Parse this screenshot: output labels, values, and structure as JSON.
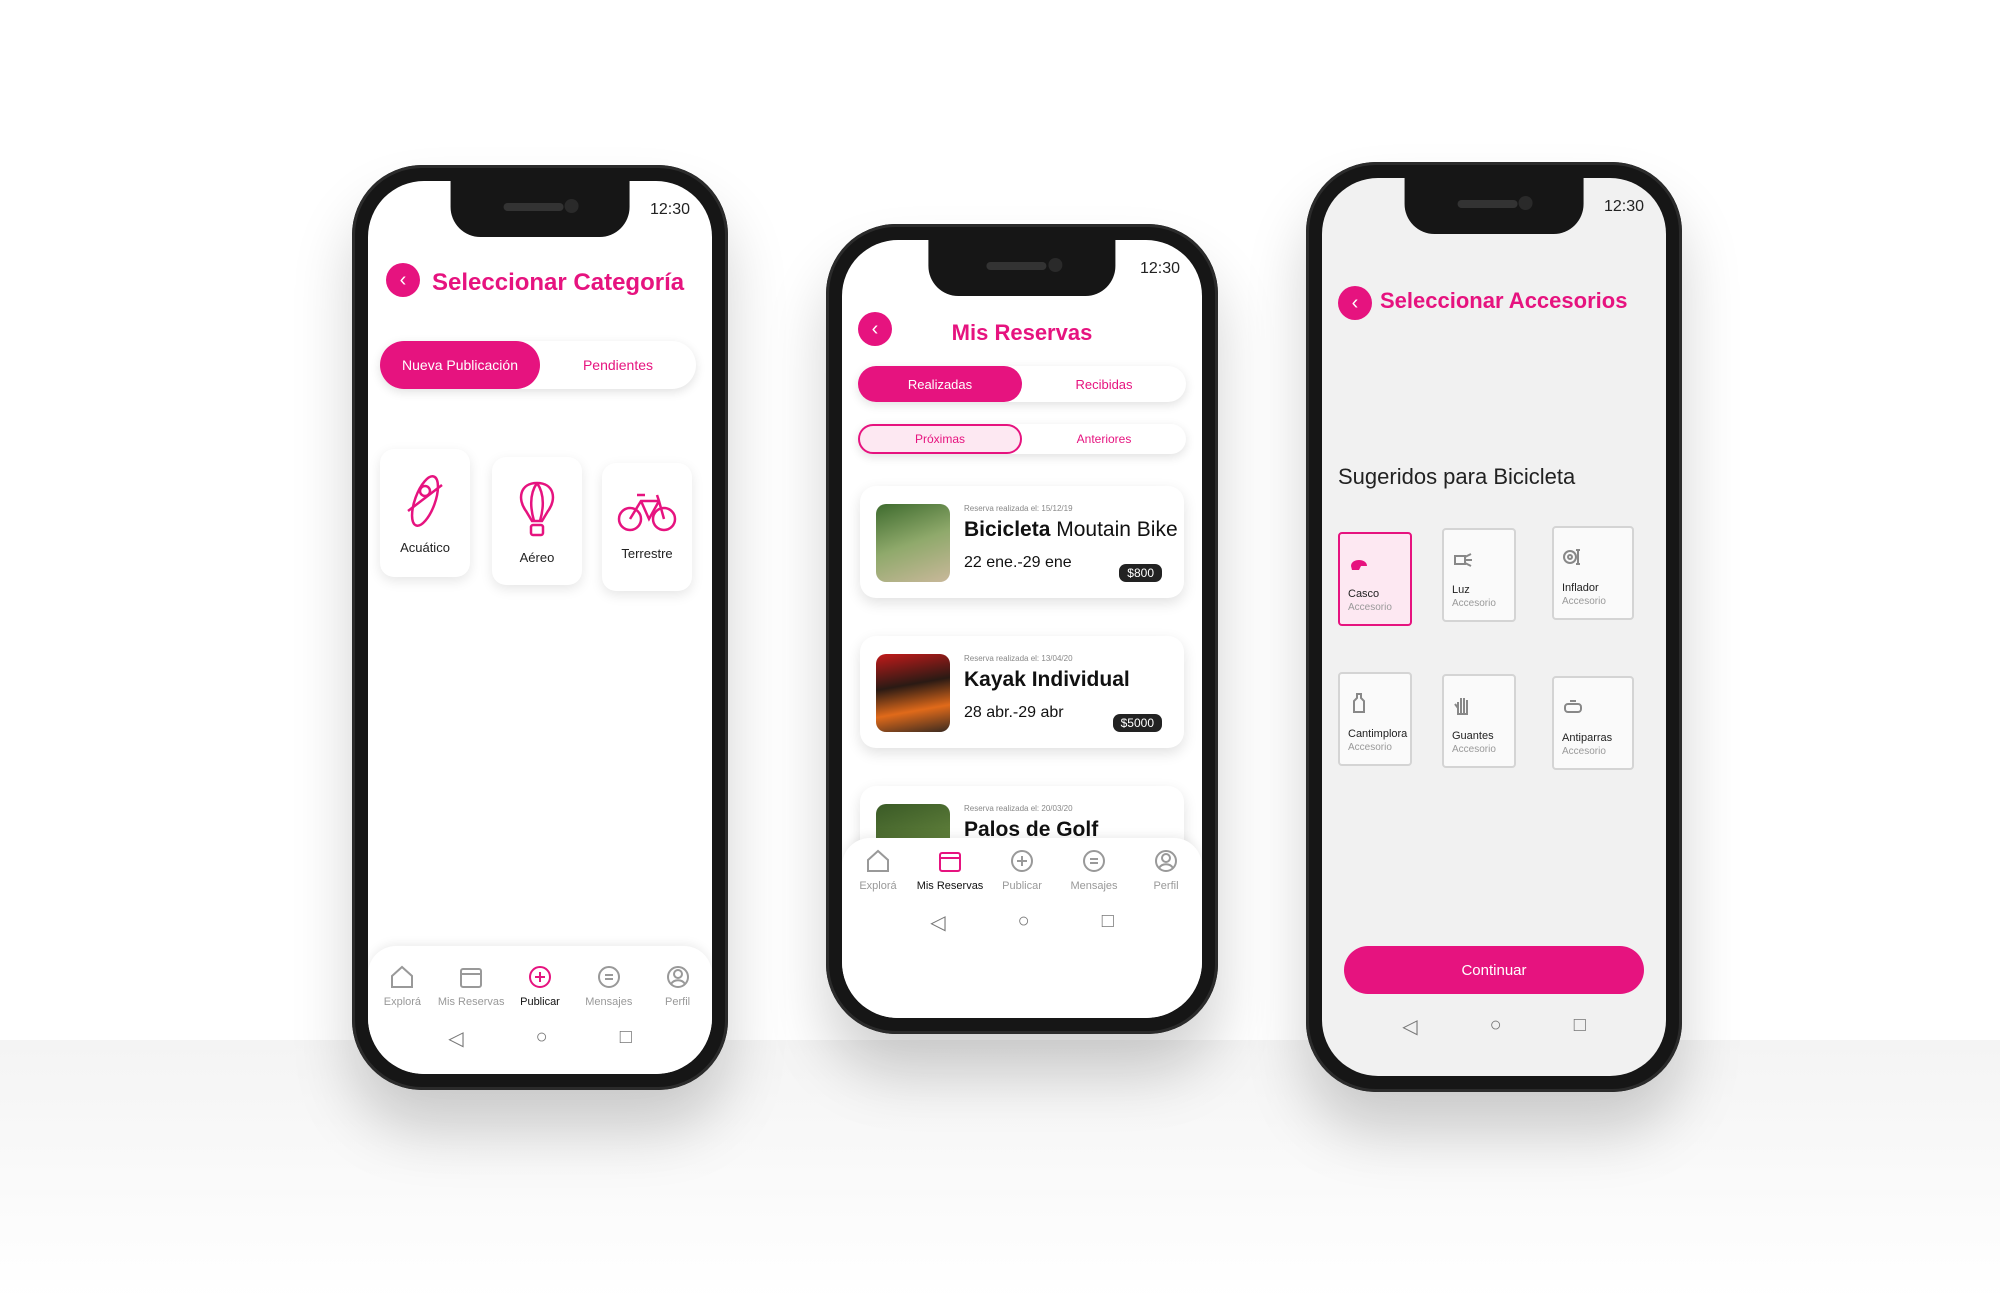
{
  "status_time": "12:30",
  "colors": {
    "accent": "#e6137f",
    "dark": "#161616"
  },
  "phone_left": {
    "title": "Seleccionar Categoría",
    "tabs": [
      {
        "label": "Nueva Publicación"
      },
      {
        "label": "Pendientes"
      }
    ],
    "categories": [
      {
        "label": "Acuático",
        "icon": "kayak-icon"
      },
      {
        "label": "Aéreo",
        "icon": "hot-air-balloon-icon"
      },
      {
        "label": "Terrestre",
        "icon": "bicycle-icon"
      }
    ],
    "nav": [
      {
        "label": "Explorá",
        "icon": "home-icon"
      },
      {
        "label": "Mis Reservas",
        "icon": "calendar-icon"
      },
      {
        "label": "Publicar",
        "icon": "plus-circle-icon"
      },
      {
        "label": "Mensajes",
        "icon": "chat-icon"
      },
      {
        "label": "Perfil",
        "icon": "user-icon"
      }
    ]
  },
  "phone_center": {
    "title": "Mis Reservas",
    "tabs": [
      {
        "label": "Realizadas"
      },
      {
        "label": "Recibidas"
      }
    ],
    "subtabs": [
      {
        "label": "Próximas"
      },
      {
        "label": "Anteriores"
      }
    ],
    "reservations": [
      {
        "meta": "Reserva realizada el: 15/12/19",
        "name_bold": "Bicicleta",
        "name_rest": "Moutain Bike",
        "dates": "22 ene.-29 ene",
        "price": "$800"
      },
      {
        "meta": "Reserva realizada el: 13/04/20",
        "name_bold": "Kayak Individual",
        "name_rest": "",
        "dates": "28 abr.-29 abr",
        "price": "$5000"
      },
      {
        "meta": "Reserva realizada el: 20/03/20",
        "name_bold": "Palos de Golf",
        "name_rest": "",
        "dates": "",
        "price": ""
      }
    ],
    "nav": [
      {
        "label": "Explorá"
      },
      {
        "label": "Mis Reservas"
      },
      {
        "label": "Publicar"
      },
      {
        "label": "Mensajes"
      },
      {
        "label": "Perfil"
      }
    ]
  },
  "phone_right": {
    "title": "Seleccionar Accesorios",
    "section": "Sugeridos para Bicicleta",
    "accessories": [
      {
        "name": "Casco",
        "sub": "Accesorio",
        "icon": "helmet-icon"
      },
      {
        "name": "Luz",
        "sub": "Accesorio",
        "icon": "light-icon"
      },
      {
        "name": "Inflador",
        "sub": "Accesorio",
        "icon": "pump-icon"
      },
      {
        "name": "Cantimplora",
        "sub": "Accesorio",
        "icon": "bottle-icon"
      },
      {
        "name": "Guantes",
        "sub": "Accesorio",
        "icon": "glove-icon"
      },
      {
        "name": "Antiparras",
        "sub": "Accesorio",
        "icon": "goggles-icon"
      }
    ],
    "cta": "Continuar"
  }
}
